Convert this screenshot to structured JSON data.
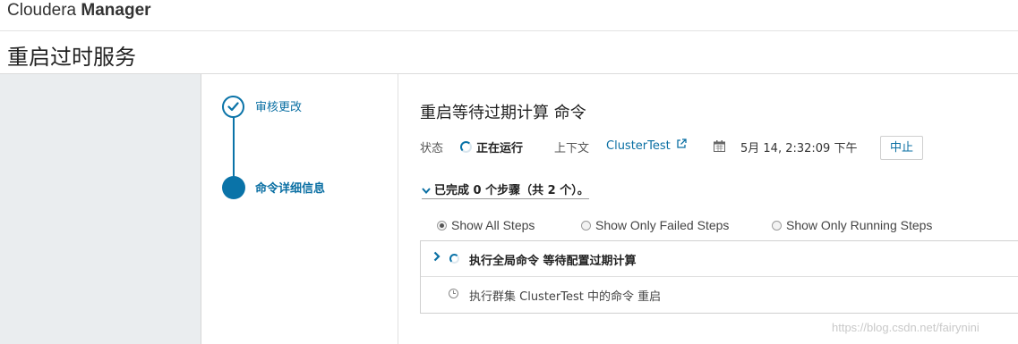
{
  "brand": {
    "part1": "Cloudera",
    "part2": "Manager"
  },
  "page_title": "重启过时服务",
  "wizard": {
    "steps": [
      {
        "label": "审核更改",
        "state": "completed"
      },
      {
        "label": "命令详细信息",
        "state": "current"
      }
    ]
  },
  "command": {
    "title": "重启等待过期计算 命令",
    "status_label": "状态",
    "status_value": "正在运行",
    "context_label": "上下文",
    "context_link": "ClusterTest",
    "datetime": "5月 14, 2:32:09 下午",
    "abort_label": "中止"
  },
  "progress_text": "已完成 0 个步骤（共 2 个）。",
  "filters": [
    {
      "label": "Show All Steps",
      "selected": true
    },
    {
      "label": "Show Only Failed Steps",
      "selected": false
    },
    {
      "label": "Show Only Running Steps",
      "selected": false
    }
  ],
  "steps": [
    {
      "text": "执行全局命令 等待配置过期计算",
      "icon": "spinner-icon",
      "expandable": true
    },
    {
      "text": "执行群集 ClusterTest 中的命令 重启",
      "icon": "clock-icon"
    }
  ],
  "watermark": "https://blog.csdn.net/fairynini",
  "colors": {
    "accent": "#0a73a8",
    "link": "#0a6fa3",
    "sidebar_bg": "#eaedef"
  }
}
